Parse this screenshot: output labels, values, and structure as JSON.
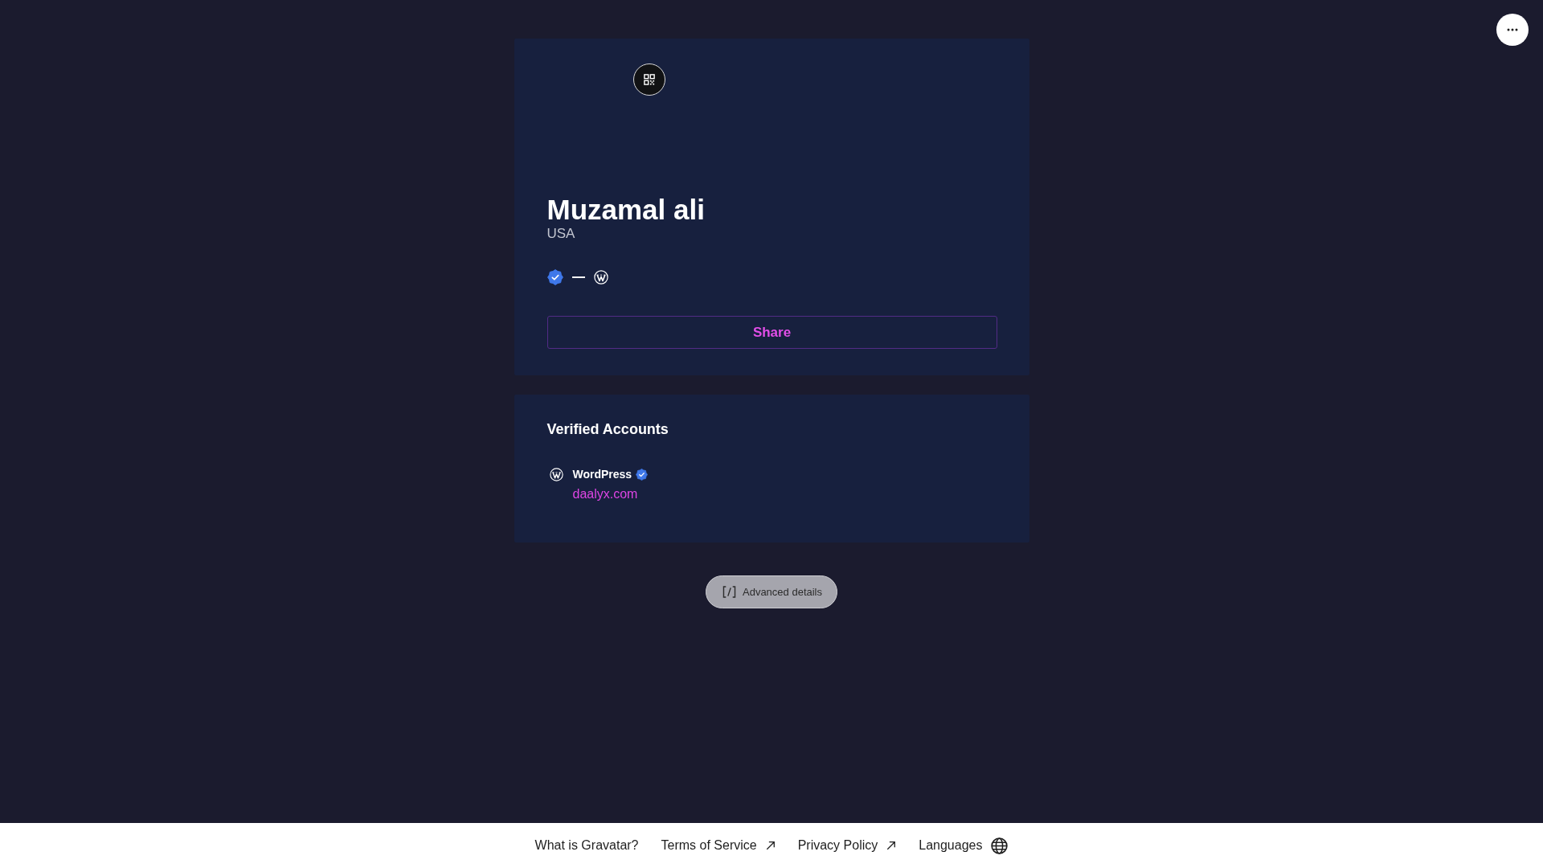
{
  "profile": {
    "name": "Muzamal ali",
    "location": "USA",
    "verified": true,
    "share_button": "Share"
  },
  "verified_accounts": {
    "title": "Verified Accounts",
    "accounts": [
      {
        "service": "WordPress",
        "verified": true,
        "url": "daalyx.com"
      }
    ]
  },
  "advanced_button": "Advanced details",
  "footer": {
    "links": [
      {
        "label": "What is Gravatar?",
        "kind": "plain"
      },
      {
        "label": "Terms of Service",
        "kind": "external"
      },
      {
        "label": "Privacy Policy",
        "kind": "external"
      },
      {
        "label": "Languages",
        "kind": "language"
      }
    ]
  }
}
